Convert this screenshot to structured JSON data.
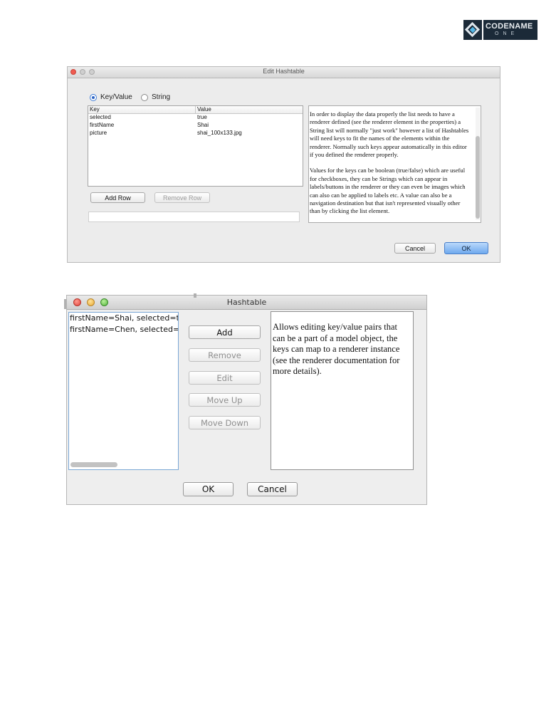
{
  "logo": {
    "brand_top": "CODENAME",
    "brand_bottom": "ONE"
  },
  "edit_hashtable": {
    "title": "Edit Hashtable",
    "radio": [
      {
        "label": "Key/Value",
        "selected": true
      },
      {
        "label": "String",
        "selected": false
      }
    ],
    "table": {
      "columns": [
        "Key",
        "Value"
      ],
      "rows": [
        {
          "key": "selected",
          "value": "true"
        },
        {
          "key": "firstName",
          "value": "Shai"
        },
        {
          "key": "picture",
          "value": "shai_100x133.jpg"
        }
      ]
    },
    "add_row_label": "Add Row",
    "remove_row_label": "Remove Row",
    "help_paragraph_1": "In order to display the data properly the list needs to have a renderer defined (see the renderer element in the properties) a String list will normally \"just work\" however a list of Hashtables will need keys to fit the names of the elements within the renderer. Normally such keys appear automatically in this editor if you defined the renderer properly.",
    "help_paragraph_2": "Values for the keys can be boolean (true/false) which are useful for checkboxes, they can be Strings which can appear in labels/buttons in the renderer or they can even be images which can also can be applied to labels etc. A value can also be a navigation destination but that isn't represented visually other than by clicking the list element.",
    "cancel_label": "Cancel",
    "ok_label": "OK"
  },
  "hashtable": {
    "title": "Hashtable",
    "list_items": [
      "firstName=Shai, selected=true",
      "firstName=Chen, selected=false"
    ],
    "buttons": {
      "add": "Add",
      "remove": "Remove",
      "edit": "Edit",
      "move_up": "Move Up",
      "move_down": "Move Down"
    },
    "help_text": "Allows editing key/value pairs that can be a part of a model object, the keys can map to a renderer instance (see the renderer documentation for more details).",
    "ok_label": "OK",
    "cancel_label": "Cancel"
  }
}
